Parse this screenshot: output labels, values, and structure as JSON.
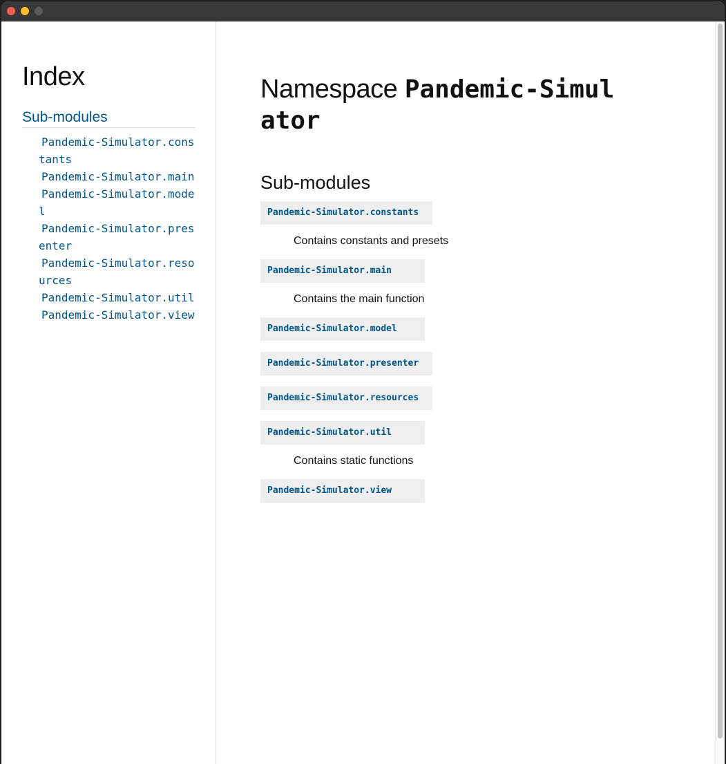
{
  "sidebar": {
    "title": "Index",
    "section_label": "Sub-modules",
    "items": [
      {
        "label": "Pandemic-Simulator.constants"
      },
      {
        "label": "Pandemic-Simulator.main"
      },
      {
        "label": "Pandemic-Simulator.model"
      },
      {
        "label": "Pandemic-Simulator.presenter"
      },
      {
        "label": "Pandemic-Simulator.resources"
      },
      {
        "label": "Pandemic-Simulator.util"
      },
      {
        "label": "Pandemic-Simulator.view"
      }
    ]
  },
  "main": {
    "title_prefix": "Namespace",
    "title_name": "Pandemic-Simulator",
    "section_heading": "Sub-modules",
    "modules": [
      {
        "name": "Pandemic-Simulator.constants",
        "description": "Contains constants and presets"
      },
      {
        "name": "Pandemic-Simulator.main",
        "description": "Contains the main function"
      },
      {
        "name": "Pandemic-Simulator.model",
        "description": ""
      },
      {
        "name": "Pandemic-Simulator.presenter",
        "description": ""
      },
      {
        "name": "Pandemic-Simulator.resources",
        "description": ""
      },
      {
        "name": "Pandemic-Simulator.util",
        "description": "Contains static functions"
      },
      {
        "name": "Pandemic-Simulator.view",
        "description": ""
      }
    ]
  },
  "colors": {
    "link": "#005588",
    "code_background": "#eeeeee",
    "text": "#111111",
    "titlebar": "#383838"
  }
}
